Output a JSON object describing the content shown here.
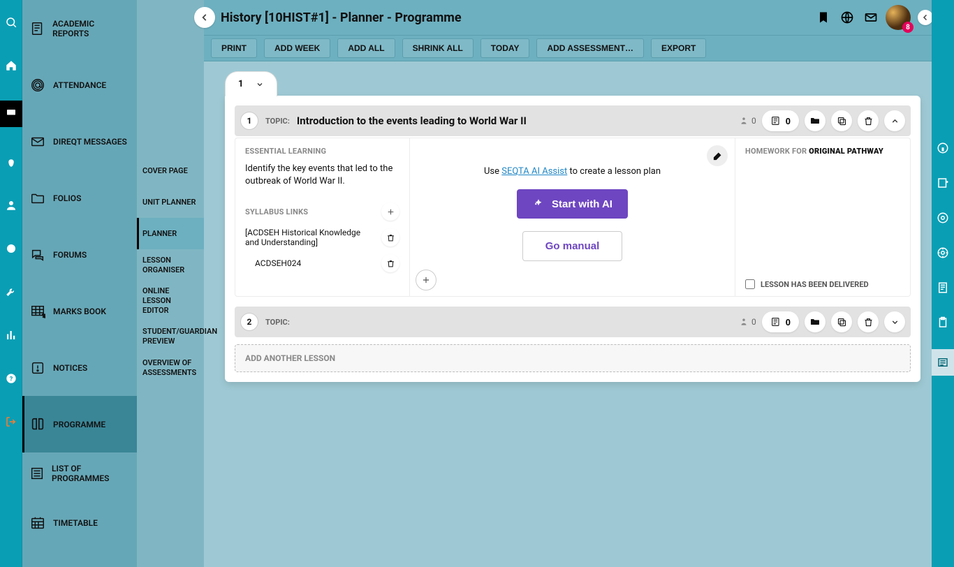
{
  "header": {
    "title": "History [10HIST#1] - Planner - Programme",
    "badge_count": "8"
  },
  "toolbar": {
    "print": "PRINT",
    "add_week": "ADD WEEK",
    "add_all": "ADD ALL",
    "shrink_all": "SHRINK ALL",
    "today": "TODAY",
    "add_assessment": "ADD ASSESSMENT…",
    "export": "EXPORT"
  },
  "nav2": {
    "items": [
      {
        "label": "ACADEMIC REPORTS"
      },
      {
        "label": "ATTENDANCE"
      },
      {
        "label": "DIREQT MESSAGES"
      },
      {
        "label": "FOLIOS"
      },
      {
        "label": "FORUMS"
      },
      {
        "label": "MARKS BOOK"
      },
      {
        "label": "NOTICES"
      },
      {
        "label": "PROGRAMME"
      },
      {
        "label": "LIST OF PROGRAMMES"
      },
      {
        "label": "TIMETABLE"
      }
    ]
  },
  "nav3": {
    "items": [
      {
        "label": "COVER PAGE"
      },
      {
        "label": "UNIT PLANNER"
      },
      {
        "label": "PLANNER"
      },
      {
        "label": "LESSON ORGANISER"
      },
      {
        "label": "ONLINE LESSON EDITOR"
      },
      {
        "label": "STUDENT/GUARDIAN PREVIEW"
      },
      {
        "label": "OVERVIEW OF ASSESSMENTS"
      }
    ]
  },
  "planner": {
    "week_number": "1",
    "lesson1": {
      "number": "1",
      "topic_label": "TOPIC:",
      "topic": "Introduction to the events leading to World War II",
      "essential_heading": "ESSENTIAL LEARNING",
      "essential_text": "Identify the key events that led to the outbreak of World War II.",
      "syllabus_heading": "SYLLABUS LINKS",
      "syllabus_item": "[ACDSEH Historical Knowledge and Understanding]",
      "syllabus_code": "ACDSEH024",
      "people_count": "0",
      "resource_count": "0",
      "ai_prefix": "Use ",
      "ai_link": "SEQTA AI Assist",
      "ai_suffix": " to create a lesson plan",
      "start_ai": "Start with AI",
      "go_manual": "Go manual",
      "homework_heading_prefix": "HOMEWORK FOR ",
      "homework_heading_path": "ORIGINAL PATHWAY",
      "delivered_label": "LESSON HAS BEEN DELIVERED"
    },
    "lesson2": {
      "number": "2",
      "topic_label": "TOPIC:",
      "people_count": "0",
      "resource_count": "0"
    },
    "add_lesson": "ADD ANOTHER LESSON"
  }
}
